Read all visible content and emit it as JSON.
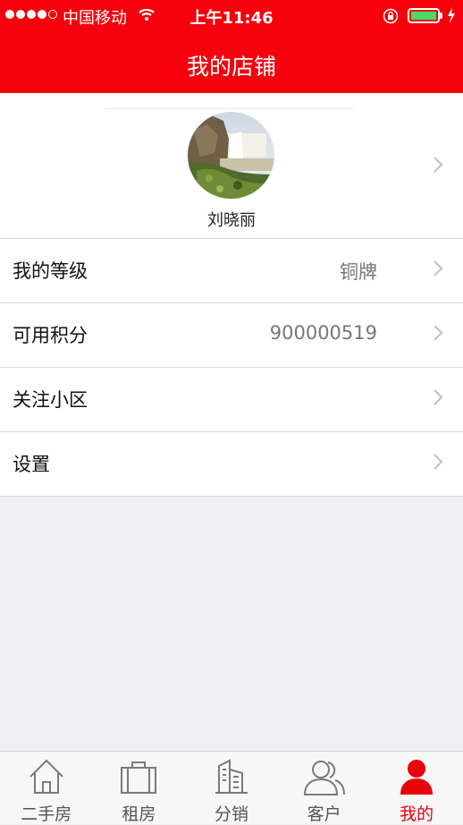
{
  "status_bar": {
    "carrier": "中国移动",
    "time": "上午11:46",
    "signal_icon": "signal-dots-icon",
    "wifi_icon": "wifi-icon",
    "lock_icon": "orientation-lock-icon",
    "battery_icon": "battery-icon",
    "charging_icon": "charging-bolt-icon",
    "battery_color": "#4cd964"
  },
  "nav": {
    "title": "我的店铺",
    "background": "#f5000c"
  },
  "profile": {
    "name": "刘晓丽",
    "avatar_icon": "waterfall-photo-avatar"
  },
  "list": [
    {
      "label": "我的等级",
      "value": "铜牌"
    },
    {
      "label": "可用积分",
      "value": "900000519"
    },
    {
      "label": "关注小区",
      "value": ""
    },
    {
      "label": "设置",
      "value": ""
    }
  ],
  "tabs": [
    {
      "label": "二手房",
      "icon": "house-icon",
      "active": false
    },
    {
      "label": "租房",
      "icon": "bag-icon",
      "active": false
    },
    {
      "label": "分销",
      "icon": "buildings-icon",
      "active": false
    },
    {
      "label": "客户",
      "icon": "people-icon",
      "active": false
    },
    {
      "label": "我的",
      "icon": "person-icon",
      "active": true
    }
  ],
  "colors": {
    "accent": "#e8000b",
    "page_background": "#efeff4"
  }
}
